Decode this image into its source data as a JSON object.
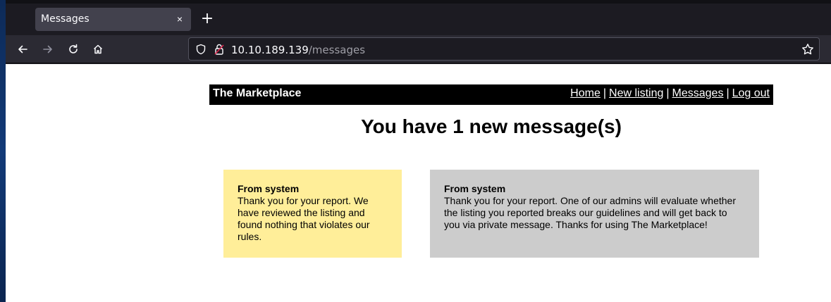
{
  "browser": {
    "tab_title": "Messages",
    "tab_close": "×",
    "new_tab": "+",
    "url_host": "10.10.189.139",
    "url_path": "/messages"
  },
  "site": {
    "title": "The Marketplace",
    "nav": [
      {
        "label": "Home"
      },
      {
        "label": "New listing"
      },
      {
        "label": "Messages"
      },
      {
        "label": "Log out"
      }
    ],
    "separator": "|"
  },
  "page": {
    "heading": "You have 1 new message(s)"
  },
  "messages": [
    {
      "from": "From system",
      "body": "Thank you for your report. We have reviewed the listing and found nothing that violates our rules.",
      "color": "#ffee99"
    },
    {
      "from": "From system",
      "body": "Thank you for your report. One of our admins will evaluate whether the listing you reported breaks our guidelines and will get back to you via private message. Thanks for using The Marketplace!",
      "color": "#cccccc"
    }
  ]
}
